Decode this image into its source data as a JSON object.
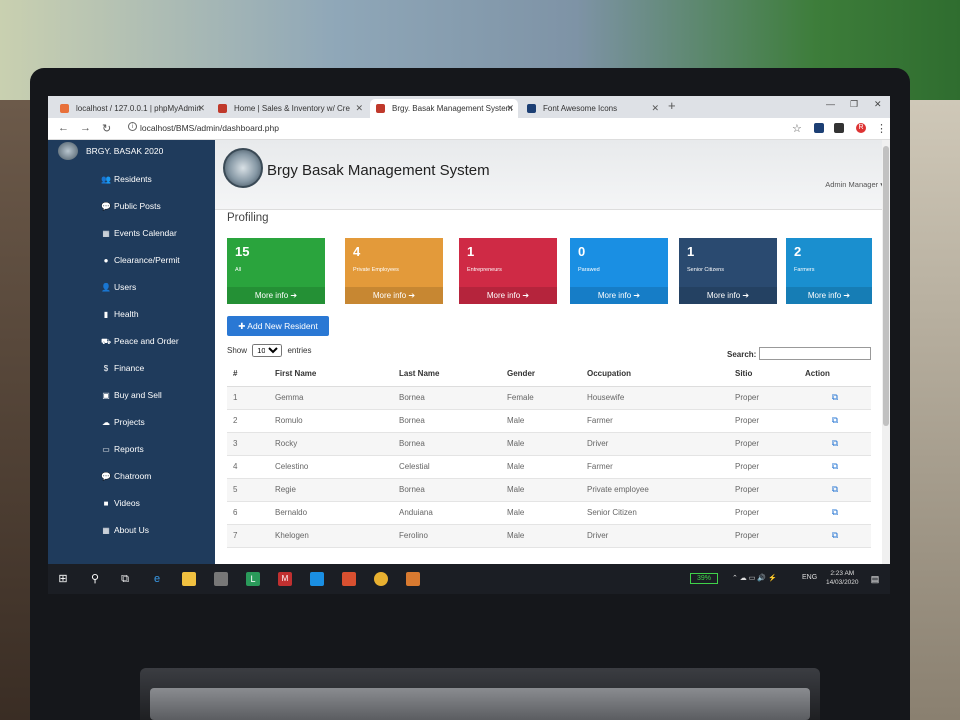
{
  "browser": {
    "tabs": [
      {
        "label": "localhost / 127.0.0.1 | phpMyAdmin",
        "active": false,
        "color": "#e8703a"
      },
      {
        "label": "Home | Sales & Inventory w/ Cre",
        "active": false,
        "color": "#c0392b"
      },
      {
        "label": "Brgy. Basak Management System",
        "active": true,
        "color": "#c0392b"
      },
      {
        "label": "Font Awesome Icons",
        "active": false,
        "color": "#1c3f74"
      }
    ],
    "url": "localhost/BMS/admin/dashboard.php",
    "profile_initial": "R"
  },
  "sidebar": {
    "brand": "BRGY. BASAK 2020",
    "items": [
      {
        "label": "Residents",
        "icon": "users-icon",
        "glyph": "👥"
      },
      {
        "label": "Public Posts",
        "icon": "comments-icon",
        "glyph": "💬"
      },
      {
        "label": "Events Calendar",
        "icon": "calendar-icon",
        "glyph": "▦"
      },
      {
        "label": "Clearance/Permit",
        "icon": "circle-icon",
        "glyph": "●"
      },
      {
        "label": "Users",
        "icon": "user-icon",
        "glyph": "👤"
      },
      {
        "label": "Health",
        "icon": "file-icon",
        "glyph": "▮"
      },
      {
        "label": "Peace and Order",
        "icon": "car-icon",
        "glyph": "⛟"
      },
      {
        "label": "Finance",
        "icon": "dollar-icon",
        "glyph": "$"
      },
      {
        "label": "Buy and Sell",
        "icon": "shopping-bag-icon",
        "glyph": "▣"
      },
      {
        "label": "Projects",
        "icon": "projects-icon",
        "glyph": "☁"
      },
      {
        "label": "Reports",
        "icon": "chart-icon",
        "glyph": "▭"
      },
      {
        "label": "Chatroom",
        "icon": "chat-icon",
        "glyph": "💬"
      },
      {
        "label": "Videos",
        "icon": "video-icon",
        "glyph": "■"
      },
      {
        "label": "About Us",
        "icon": "info-icon",
        "glyph": "▦"
      }
    ]
  },
  "header": {
    "title": "Brgy Basak Management System",
    "admin": "Admin Manager ▾"
  },
  "section_title": "Profiling",
  "cards": [
    {
      "count": "15",
      "label": "All",
      "more": "More info ➔",
      "color": "#2aa43d"
    },
    {
      "count": "4",
      "label": "Private Employees",
      "more": "More info ➔",
      "color": "#e39a3a"
    },
    {
      "count": "1",
      "label": "Entrepreneurs",
      "more": "More info ➔",
      "color": "#cf2a45"
    },
    {
      "count": "0",
      "label": "Parawed",
      "more": "More info ➔",
      "color": "#1a8fe3"
    },
    {
      "count": "1",
      "label": "Senior Citizens",
      "more": "More info ➔",
      "color": "#2a4a70"
    },
    {
      "count": "2",
      "label": "Farmers",
      "more": "More info ➔",
      "color": "#1a8fcf"
    }
  ],
  "add_button": "✚ Add New Resident",
  "table_controls": {
    "show_label": "Show",
    "entries_value": "10",
    "entries_label": "entries",
    "search_label": "Search:"
  },
  "table": {
    "headers": [
      "#",
      "First Name",
      "Last Name",
      "Gender",
      "Occupation",
      "Sitio",
      "Action"
    ],
    "rows": [
      [
        "1",
        "Gemma",
        "Bornea",
        "Female",
        "Housewife",
        "Proper"
      ],
      [
        "2",
        "Romulo",
        "Bornea",
        "Male",
        "Farmer",
        "Proper"
      ],
      [
        "3",
        "Rocky",
        "Bornea",
        "Male",
        "Driver",
        "Proper"
      ],
      [
        "4",
        "Celestino",
        "Celestial",
        "Male",
        "Farmer",
        "Proper"
      ],
      [
        "5",
        "Regie",
        "Bornea",
        "Male",
        "Private employee",
        "Proper"
      ],
      [
        "6",
        "Bernaldo",
        "Anduiana",
        "Male",
        "Senior Citizen",
        "Proper"
      ],
      [
        "7",
        "Khelogen",
        "Ferolino",
        "Male",
        "Driver",
        "Proper"
      ]
    ],
    "action_icon": "edit-icon"
  },
  "taskbar": {
    "battery": "39%",
    "lang": "ENG",
    "time": "2:23 AM",
    "date": "14/03/2020"
  }
}
